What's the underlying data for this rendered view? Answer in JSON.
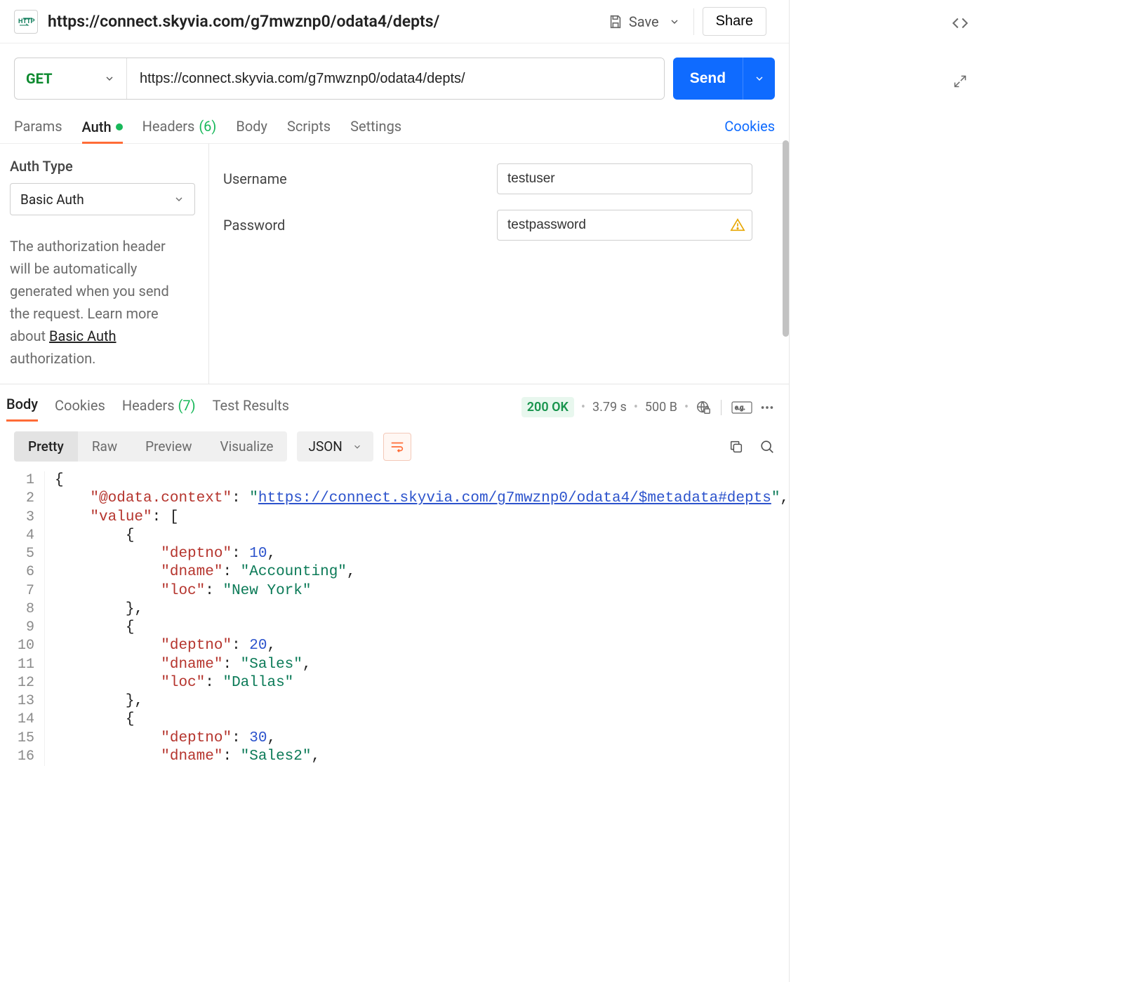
{
  "header": {
    "title": "https://connect.skyvia.com/g7mwznp0/odata4/depts/",
    "save": "Save",
    "share": "Share"
  },
  "request": {
    "method": "GET",
    "url": "https://connect.skyvia.com/g7mwznp0/odata4/depts/",
    "send": "Send",
    "tabs": {
      "params": "Params",
      "authorization": "Auth",
      "headers": "Headers",
      "headers_count": "(6)",
      "body": "Body",
      "scripts": "Scripts",
      "settings": "Settings"
    },
    "cookies_link": "Cookies"
  },
  "auth": {
    "type_label": "Auth Type",
    "type_value": "Basic Auth",
    "help_pre": "The authorization header will be automatically generated when you send the request. Learn more about ",
    "help_link": "Basic Auth",
    "help_post": " authorization.",
    "username_label": "Username",
    "username_value": "testuser",
    "password_label": "Password",
    "password_value": "testpassword"
  },
  "response": {
    "tabs": {
      "body": "Body",
      "cookies": "Cookies",
      "headers": "Headers",
      "headers_count": "(7)",
      "testresults": "Test Results"
    },
    "status": "200 OK",
    "time": "3.79 s",
    "size": "500 B",
    "format": {
      "pretty": "Pretty",
      "raw": "Raw",
      "preview": "Preview",
      "visualize": "Visualize",
      "lang": "JSON"
    },
    "body_data": {
      "@odata.context": "https://connect.skyvia.com/g7mwznp0/odata4/$metadata#depts",
      "value": [
        {
          "deptno": 10,
          "dname": "Accounting",
          "loc": "New York"
        },
        {
          "deptno": 20,
          "dname": "Sales",
          "loc": "Dallas"
        },
        {
          "deptno": 30,
          "dname": "Sales2"
        }
      ]
    },
    "body_lines": [
      [
        {
          "t": "{",
          "c": "punct"
        }
      ],
      [
        {
          "t": "    ",
          "c": ""
        },
        {
          "t": "\"@odata.context\"",
          "c": "tok-key"
        },
        {
          "t": ": ",
          "c": "punct"
        },
        {
          "t": "\"",
          "c": "tok-str"
        },
        {
          "t": "https://connect.skyvia.com/g7mwznp0/odata4/$metadata#depts",
          "c": "tok-url"
        },
        {
          "t": "\"",
          "c": "tok-str"
        },
        {
          "t": ",",
          "c": "punct"
        }
      ],
      [
        {
          "t": "    ",
          "c": ""
        },
        {
          "t": "\"value\"",
          "c": "tok-key"
        },
        {
          "t": ": [",
          "c": "punct"
        }
      ],
      [
        {
          "t": "        ",
          "c": ""
        },
        {
          "t": "{",
          "c": "punct"
        }
      ],
      [
        {
          "t": "            ",
          "c": ""
        },
        {
          "t": "\"deptno\"",
          "c": "tok-key"
        },
        {
          "t": ": ",
          "c": "punct"
        },
        {
          "t": "10",
          "c": "tok-num"
        },
        {
          "t": ",",
          "c": "punct"
        }
      ],
      [
        {
          "t": "            ",
          "c": ""
        },
        {
          "t": "\"dname\"",
          "c": "tok-key"
        },
        {
          "t": ": ",
          "c": "punct"
        },
        {
          "t": "\"Accounting\"",
          "c": "tok-str"
        },
        {
          "t": ",",
          "c": "punct"
        }
      ],
      [
        {
          "t": "            ",
          "c": ""
        },
        {
          "t": "\"loc\"",
          "c": "tok-key"
        },
        {
          "t": ": ",
          "c": "punct"
        },
        {
          "t": "\"New York\"",
          "c": "tok-str"
        }
      ],
      [
        {
          "t": "        ",
          "c": ""
        },
        {
          "t": "},",
          "c": "punct"
        }
      ],
      [
        {
          "t": "        ",
          "c": ""
        },
        {
          "t": "{",
          "c": "punct"
        }
      ],
      [
        {
          "t": "            ",
          "c": ""
        },
        {
          "t": "\"deptno\"",
          "c": "tok-key"
        },
        {
          "t": ": ",
          "c": "punct"
        },
        {
          "t": "20",
          "c": "tok-num"
        },
        {
          "t": ",",
          "c": "punct"
        }
      ],
      [
        {
          "t": "            ",
          "c": ""
        },
        {
          "t": "\"dname\"",
          "c": "tok-key"
        },
        {
          "t": ": ",
          "c": "punct"
        },
        {
          "t": "\"Sales\"",
          "c": "tok-str"
        },
        {
          "t": ",",
          "c": "punct"
        }
      ],
      [
        {
          "t": "            ",
          "c": ""
        },
        {
          "t": "\"loc\"",
          "c": "tok-key"
        },
        {
          "t": ": ",
          "c": "punct"
        },
        {
          "t": "\"Dallas\"",
          "c": "tok-str"
        }
      ],
      [
        {
          "t": "        ",
          "c": ""
        },
        {
          "t": "},",
          "c": "punct"
        }
      ],
      [
        {
          "t": "        ",
          "c": ""
        },
        {
          "t": "{",
          "c": "punct"
        }
      ],
      [
        {
          "t": "            ",
          "c": ""
        },
        {
          "t": "\"deptno\"",
          "c": "tok-key"
        },
        {
          "t": ": ",
          "c": "punct"
        },
        {
          "t": "30",
          "c": "tok-num"
        },
        {
          "t": ",",
          "c": "punct"
        }
      ],
      [
        {
          "t": "            ",
          "c": ""
        },
        {
          "t": "\"dname\"",
          "c": "tok-key"
        },
        {
          "t": ": ",
          "c": "punct"
        },
        {
          "t": "\"Sales2\"",
          "c": "tok-str"
        },
        {
          "t": ",",
          "c": "punct"
        }
      ]
    ]
  }
}
